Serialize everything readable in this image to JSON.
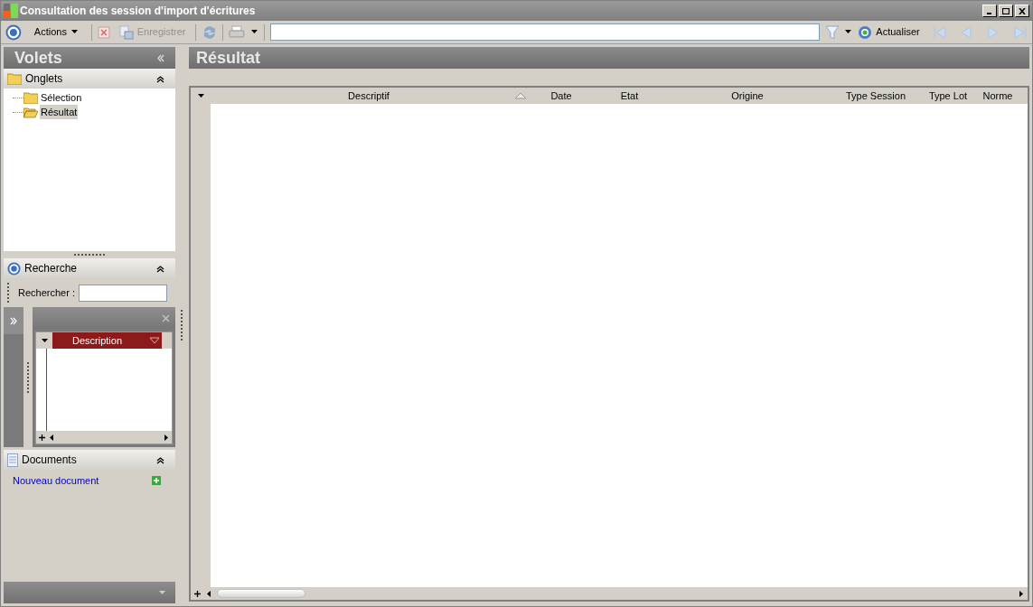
{
  "window": {
    "title": "Consultation des session d'import d'écritures"
  },
  "toolbar": {
    "actions": "Actions",
    "save": {
      "label": "Enregistrer",
      "disabled": true
    },
    "refresh": "Actualiser"
  },
  "panes": {
    "title": "Volets",
    "tabs_section": {
      "title": "Onglets",
      "items": [
        {
          "label": "Sélection",
          "selected": false
        },
        {
          "label": "Résultat",
          "selected": true
        }
      ]
    },
    "search_section": {
      "title": "Recherche",
      "label": "Rechercher :",
      "grid_column": "Description"
    },
    "documents_section": {
      "title": "Documents",
      "link": "Nouveau document"
    }
  },
  "result": {
    "title": "Résultat",
    "columns": [
      "Descriptif",
      "Date",
      "Etat",
      "Origine",
      "Type Session",
      "Type Lot",
      "Norme"
    ]
  }
}
